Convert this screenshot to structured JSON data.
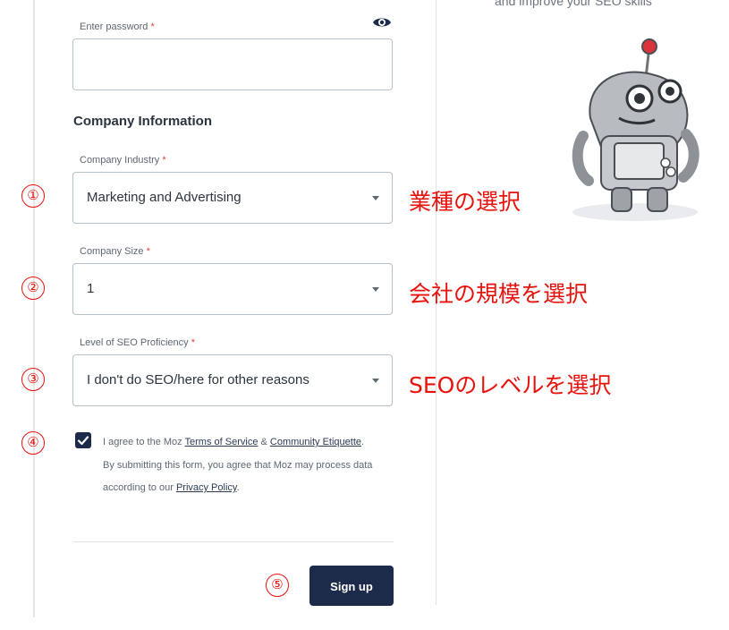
{
  "form": {
    "password": {
      "label": "Enter password",
      "required_mark": "*",
      "value": ""
    },
    "section_title": "Company Information",
    "industry": {
      "label": "Company Industry",
      "required_mark": "*",
      "value": "Marketing and Advertising"
    },
    "size": {
      "label": "Company Size",
      "required_mark": "*",
      "value": "1"
    },
    "seo_level": {
      "label": "Level of SEO Proficiency",
      "required_mark": "*",
      "value": "I don't do SEO/here for other reasons"
    },
    "consent": {
      "checked": true,
      "prefix": "I agree to the Moz ",
      "terms_link": "Terms of Service",
      "amp": " & ",
      "community_link": "Community Etiquette",
      "after": ".",
      "line2": "By submitting this form, you agree that Moz may process data according to our ",
      "privacy_link": "Privacy Policy",
      "end": "."
    },
    "signup_label": "Sign up"
  },
  "promo": {
    "text": "and improve your SEO skills"
  },
  "annotations": {
    "steps": [
      "①",
      "②",
      "③",
      "④",
      "⑤"
    ],
    "industry_note": "業種の選択",
    "size_note": "会社の規模を選択",
    "seo_note": "SEOのレベルを選択"
  },
  "colors": {
    "accent": "#1c2b4a",
    "annotation": "#e8120c",
    "required": "#e0413b",
    "border": "#b7bfc8"
  },
  "icons": {
    "password_toggle": "eye-icon",
    "select_caret": "caret-down-icon",
    "checkbox_check": "checkmark-icon",
    "mascot": "moz-robot-illustration"
  }
}
